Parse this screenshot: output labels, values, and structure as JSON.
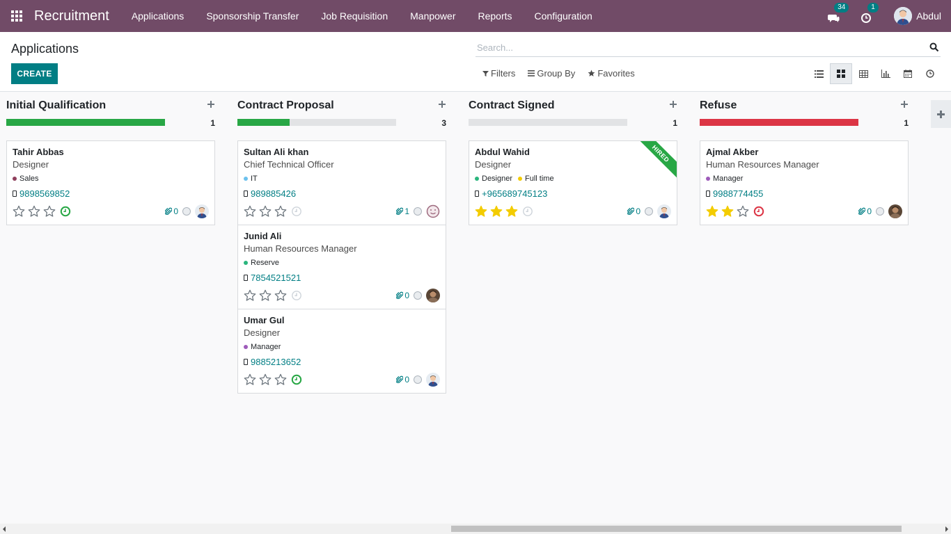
{
  "navbar": {
    "brand": "Recruitment",
    "menu": [
      "Applications",
      "Sponsorship Transfer",
      "Job Requisition",
      "Manpower",
      "Reports",
      "Configuration"
    ],
    "messages_count": "34",
    "activities_count": "1",
    "user_name": "Abdul"
  },
  "control_panel": {
    "title": "Applications",
    "create_label": "CREATE",
    "search_placeholder": "Search...",
    "filters_label": "Filters",
    "group_by_label": "Group By",
    "favorites_label": "Favorites",
    "views": [
      "list-view-icon",
      "kanban-view-icon",
      "pivot-view-icon",
      "graph-view-icon",
      "calendar-view-icon",
      "activity-view-icon"
    ],
    "active_view": "kanban"
  },
  "colors": {
    "navbar": "#714b67",
    "primary": "#017e84",
    "green": "#28a745",
    "red": "#dc3545",
    "star_filled": "#f3cc00"
  },
  "columns": [
    {
      "title": "Initial Qualification",
      "count": "1",
      "progress": [
        {
          "color": "#28a745",
          "fraction": 1.0
        }
      ],
      "cards": [
        {
          "name": "Tahir Abbas",
          "job": "Designer",
          "tags": [
            {
              "label": "Sales",
              "color": "#8f3f5c"
            }
          ],
          "phone": "9898569852",
          "stars": 0,
          "activity": "green",
          "attachments": "0",
          "avatar": "person"
        }
      ]
    },
    {
      "title": "Contract Proposal",
      "count": "3",
      "progress": [
        {
          "color": "#28a745",
          "fraction": 0.33
        }
      ],
      "cards": [
        {
          "name": "Sultan Ali khan",
          "job": "Chief Technical Officer",
          "tags": [
            {
              "label": "IT",
              "color": "#6cc1ed"
            }
          ],
          "phone": "989885426",
          "stars": 0,
          "activity": "none",
          "attachments": "1",
          "avatar": "smiley"
        },
        {
          "name": "Junid Ali",
          "job": "Human Resources Manager",
          "tags": [
            {
              "label": "Reserve",
              "color": "#2ab57d"
            }
          ],
          "phone": "7854521521",
          "stars": 0,
          "activity": "none",
          "attachments": "0",
          "avatar": "photo"
        },
        {
          "name": "Umar Gul",
          "job": "Designer",
          "tags": [
            {
              "label": "Manager",
              "color": "#9e5bba"
            }
          ],
          "phone": "9885213652",
          "stars": 0,
          "activity": "green",
          "attachments": "0",
          "avatar": "person"
        }
      ]
    },
    {
      "title": "Contract Signed",
      "count": "1",
      "progress": [],
      "cards": [
        {
          "name": "Abdul Wahid",
          "job": "Designer",
          "tags": [
            {
              "label": "Designer",
              "color": "#2ab57d"
            },
            {
              "label": "Full time",
              "color": "#f3cc00"
            }
          ],
          "phone": "+965689745123",
          "stars": 3,
          "activity": "none",
          "attachments": "0",
          "avatar": "person",
          "ribbon": "HIRED"
        }
      ]
    },
    {
      "title": "Refuse",
      "count": "1",
      "progress": [
        {
          "color": "#dc3545",
          "fraction": 1.0
        }
      ],
      "cards": [
        {
          "name": "Ajmal Akber",
          "job": "Human Resources Manager",
          "tags": [
            {
              "label": "Manager",
              "color": "#9e5bba"
            }
          ],
          "phone": "9988774455",
          "stars": 2,
          "activity": "red",
          "attachments": "0",
          "avatar": "photo"
        }
      ]
    }
  ]
}
